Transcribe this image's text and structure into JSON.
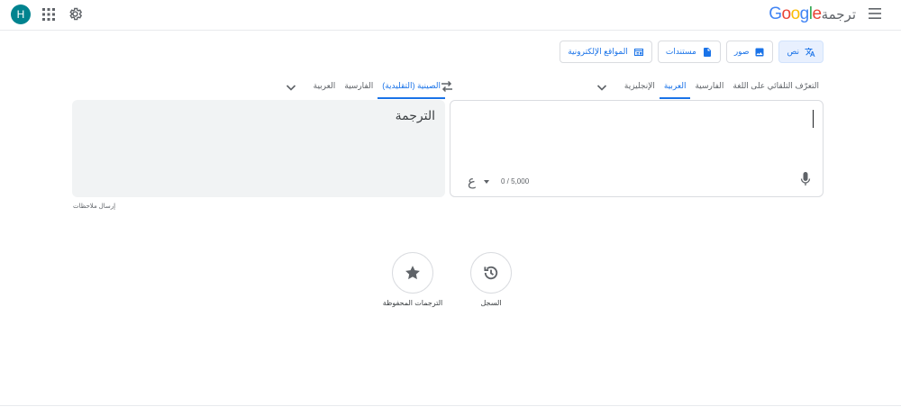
{
  "header": {
    "logo_google": "Google",
    "logo_product": "ترجمة",
    "avatar_letter": "H",
    "icons": [
      "menu-icon",
      "apps-icon",
      "gear-icon"
    ]
  },
  "modes": [
    {
      "label": "نص",
      "icon": "translate-icon",
      "active": true
    },
    {
      "label": "صور",
      "icon": "image-icon",
      "active": false
    },
    {
      "label": "مستندات",
      "icon": "document-icon",
      "active": false
    },
    {
      "label": "المواقع الإلكترونية",
      "icon": "website-icon",
      "active": false
    }
  ],
  "source_langs": {
    "items": [
      "التعرّف التلقائي على اللغة",
      "الفارسية",
      "العربية",
      "الإنجليزية"
    ],
    "selected": "العربية"
  },
  "target_langs": {
    "items": [
      "الصينية (التقليدية)",
      "الفارسية",
      "العربية"
    ],
    "selected": "الصينية (التقليدية)"
  },
  "source_panel": {
    "value": "",
    "counter": "0 / 5,000",
    "input_tool_glyph": "ع"
  },
  "target_panel": {
    "placeholder": "الترجمة"
  },
  "feedback_label": "إرسال ملاحظات",
  "bottom": {
    "history_label": "السجل",
    "saved_label": "الترجمات المحفوظة"
  },
  "colors": {
    "accent": "#1a73e8",
    "avatar": "#00838f",
    "active_mode_bg": "#e8f0fe",
    "target_panel_bg": "#f1f3f4"
  }
}
